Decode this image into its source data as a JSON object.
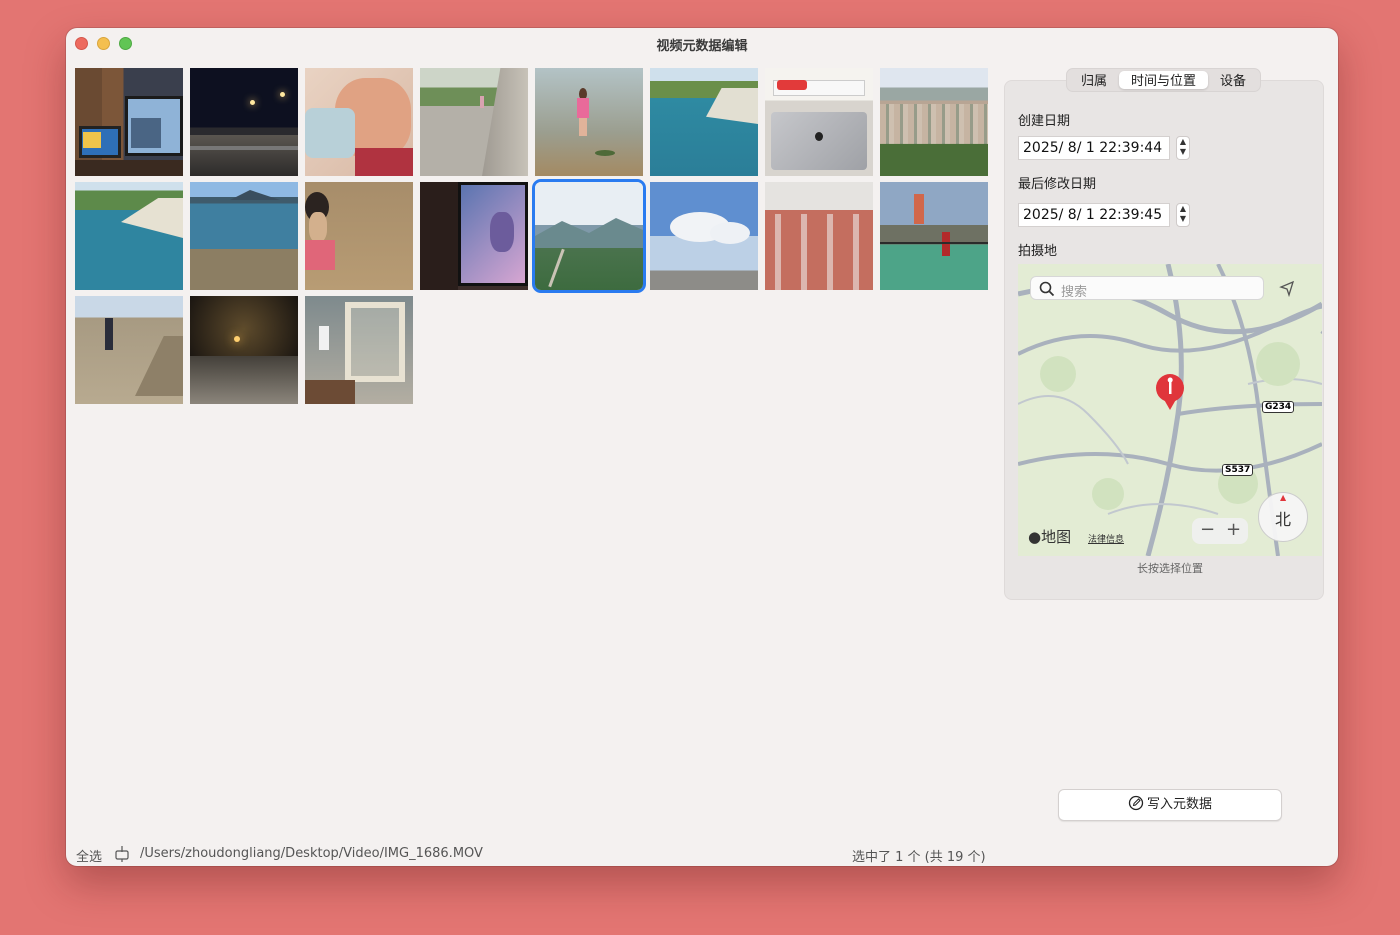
{
  "window": {
    "title": "视频元数据编辑"
  },
  "tabs": [
    {
      "label": "归属"
    },
    {
      "label": "时间与位置"
    },
    {
      "label": "设备"
    }
  ],
  "active_tab": "时间与位置",
  "fields": {
    "created_label": "创建日期",
    "created_value": "2025/  8/   1 22:39:44",
    "modified_label": "最后修改日期",
    "modified_value": "2025/  8/   1 22:39:45",
    "location_label": "拍摄地"
  },
  "map": {
    "search_placeholder": "搜索",
    "brand": "地图",
    "legal": "法律信息",
    "road_1": "G234",
    "road_2": "S537",
    "compass": "北",
    "zoom_out": "−",
    "zoom_in": "+",
    "hint": "长按选择位置"
  },
  "write_button": "写入元数据",
  "statusbar": {
    "select_all": "全选",
    "path": "/Users/zhoudongliang/Desktop/Video/IMG_1686.MOV",
    "selection": "选中了 1 个 (共 19 个)"
  },
  "thumbnails": [
    {
      "name": "living room tv",
      "selected": false
    },
    {
      "name": "night road",
      "selected": false
    },
    {
      "name": "sleeping child",
      "selected": false
    },
    {
      "name": "path by wall",
      "selected": false
    },
    {
      "name": "child in water",
      "selected": false
    },
    {
      "name": "river bend",
      "selected": false
    },
    {
      "name": "laptop on desk",
      "selected": false
    },
    {
      "name": "town from hill",
      "selected": false
    },
    {
      "name": "river shore",
      "selected": false
    },
    {
      "name": "lake and mountains",
      "selected": false
    },
    {
      "name": "child on sand",
      "selected": false
    },
    {
      "name": "screen dark room",
      "selected": false
    },
    {
      "name": "mountain valley",
      "selected": true
    },
    {
      "name": "sky and clouds",
      "selected": false
    },
    {
      "name": "brick building",
      "selected": false
    },
    {
      "name": "basketball court",
      "selected": false
    },
    {
      "name": "person on beach",
      "selected": false
    },
    {
      "name": "night tunnel",
      "selected": false
    },
    {
      "name": "bunk bed room",
      "selected": false
    }
  ],
  "colors": {
    "selection": "#2a7bf0",
    "pin": "#e0353b"
  }
}
